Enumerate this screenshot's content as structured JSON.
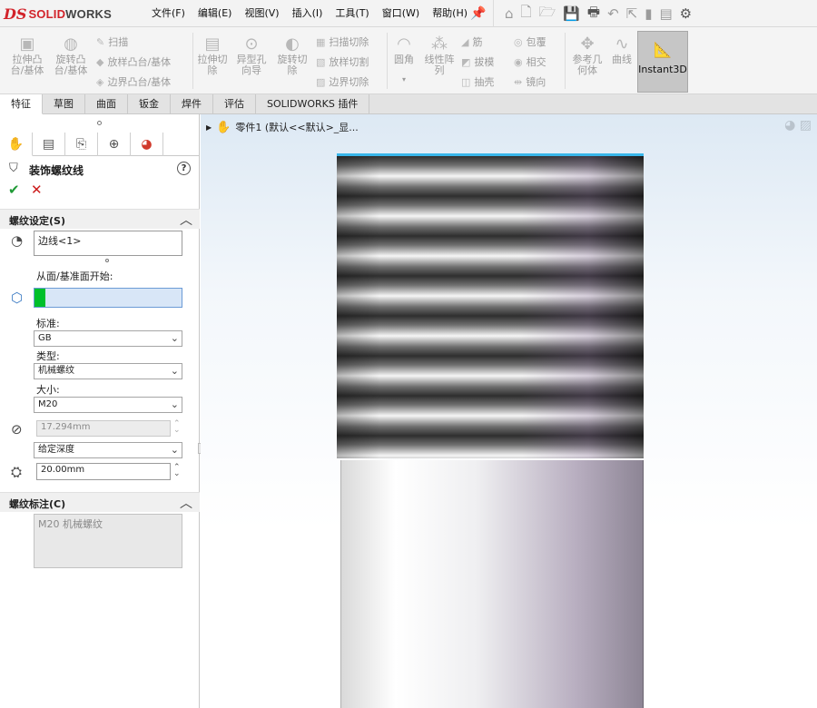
{
  "app": {
    "logo_ds": "DS",
    "logo_brand_a": "SOLID",
    "logo_brand_b": "WORKS"
  },
  "menu": [
    "文件(F)",
    "编辑(E)",
    "视图(V)",
    "插入(I)",
    "工具(T)",
    "窗口(W)",
    "帮助(H)"
  ],
  "command_manager": {
    "extrude_boss": "拉伸凸台/基体",
    "revolve_boss": "旋转凸台/基体",
    "sweep": "扫描",
    "loft_boss": "放样凸台/基体",
    "boundary_boss": "边界凸台/基体",
    "extrude_cut": "拉伸切除",
    "hole_wizard": "异型孔向导",
    "revolve_cut": "旋转切除",
    "swept_cut": "扫描切除",
    "lofted_cut": "放样切割",
    "boundary_cut": "边界切除",
    "fillet": "圆角",
    "linear_pattern": "线性阵列",
    "rib": "筋",
    "draft": "拔模",
    "shell": "抽壳",
    "wrap": "包覆",
    "intersect": "相交",
    "mirror": "镜向",
    "reference_geometry": "参考几何体",
    "curves": "曲线",
    "instant3d": "Instant3D"
  },
  "tabs": [
    "特征",
    "草图",
    "曲面",
    "钣金",
    "焊件",
    "评估",
    "SOLIDWORKS 插件"
  ],
  "property_manager": {
    "title": "装饰螺纹线",
    "help": "?",
    "ok_icon": "✔",
    "cancel_icon": "✕",
    "thread_settings": {
      "header": "螺纹设定(S)",
      "edge_value": "边线<1>",
      "start_label": "从面/基准面开始:",
      "start_value": "",
      "standard_label": "标准:",
      "standard_value": "GB",
      "type_label": "类型:",
      "type_value": "机械螺纹",
      "size_label": "大小:",
      "size_value": "M20",
      "minor_diameter": "17.294mm",
      "end_condition": "给定深度",
      "depth": "20.00mm"
    },
    "thread_callout": {
      "header": "螺纹标注(C)",
      "value": "M20 机械螺纹"
    }
  },
  "viewport": {
    "tree_text": "零件1  (默认<<默认>_显..."
  },
  "colors": {
    "accent": "#1e66c8",
    "ok": "#1f9a36",
    "cancel": "#cc1b1b",
    "selection_highlight": "#38b6ea",
    "face_selector": "#00c02b"
  },
  "icons": [
    "home-icon",
    "new-file-icon",
    "open-icon",
    "save-icon",
    "print-icon",
    "undo-icon",
    "select-icon",
    "options-icon",
    "part-icon",
    "help-icon"
  ]
}
